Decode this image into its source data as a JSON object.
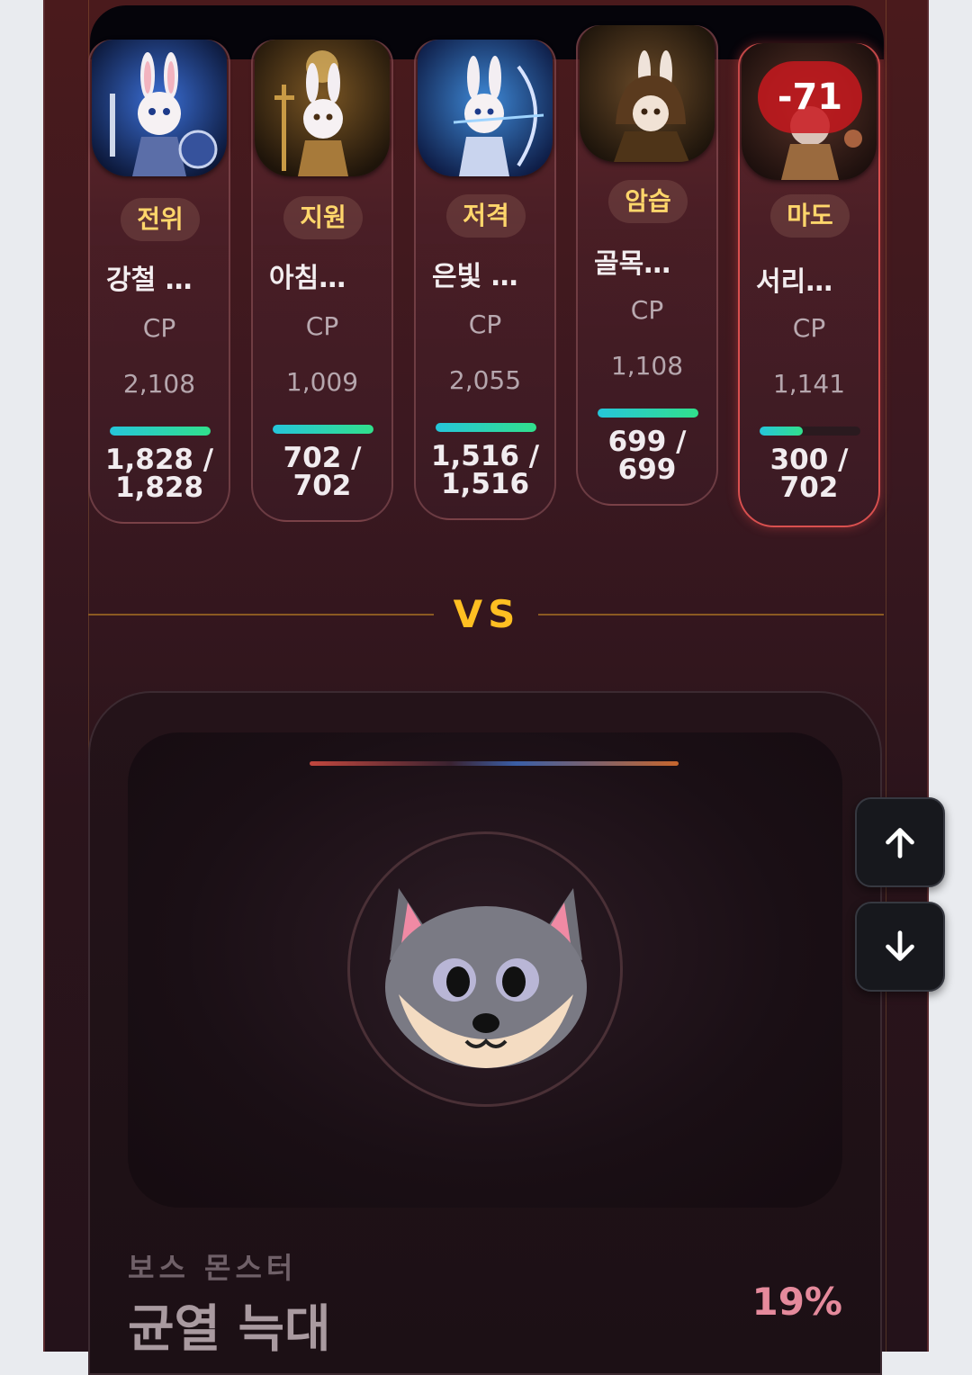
{
  "party": [
    {
      "role": "전위",
      "name": "강철 …",
      "cp_label": "CP",
      "cp": "2,108",
      "hp_current": "1,828",
      "hp_max": "1,828",
      "hp_ratio": 1.0,
      "portrait_icon": "rabbit-knight-portrait"
    },
    {
      "role": "지원",
      "name": "아침…",
      "cp_label": "CP",
      "cp": "1,009",
      "hp_current": "702",
      "hp_max": "702",
      "hp_ratio": 1.0,
      "portrait_icon": "rabbit-priest-portrait"
    },
    {
      "role": "저격",
      "name": "은빛 …",
      "cp_label": "CP",
      "cp": "2,055",
      "hp_current": "1,516",
      "hp_max": "1,516",
      "hp_ratio": 1.0,
      "portrait_icon": "rabbit-archer-portrait"
    },
    {
      "role": "암습",
      "name": "골목…",
      "cp_label": "CP",
      "cp": "1,108",
      "hp_current": "699",
      "hp_max": "699",
      "hp_ratio": 1.0,
      "portrait_icon": "rabbit-rogue-portrait"
    },
    {
      "role": "마도",
      "name": "서리…",
      "cp_label": "CP",
      "cp": "1,141",
      "hp_current": "300",
      "hp_max": "702",
      "hp_ratio": 0.43,
      "portrait_icon": "rabbit-mage-portrait",
      "damage_popup": "-71"
    }
  ],
  "versus_label": "VS",
  "boss": {
    "subtitle": "보스 몬스터",
    "name": "균열 늑대",
    "percent": "19%",
    "icon": "wolf-face-icon"
  },
  "scroll_controls": {
    "up_icon": "arrow-up-icon",
    "down_icon": "arrow-down-icon"
  },
  "colors": {
    "accent_gold": "#ffbf22",
    "role_text": "#ffd66b",
    "hp_bar": "#26c6da",
    "damage": "#c81e1e"
  }
}
